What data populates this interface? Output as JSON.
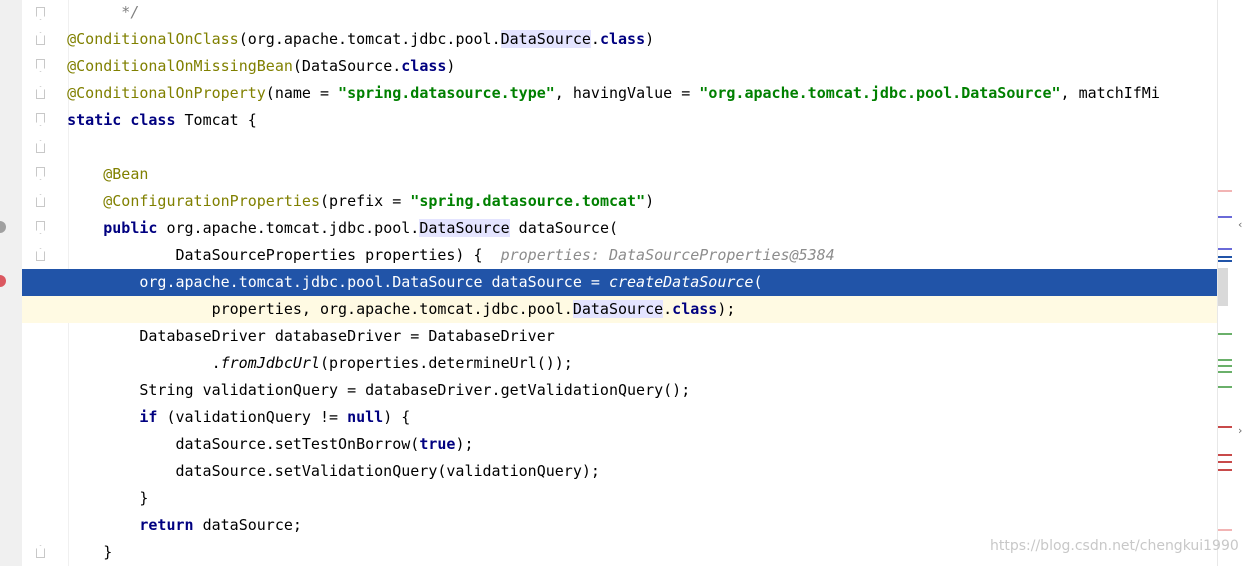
{
  "editor": {
    "lines": [
      {
        "indent": 10,
        "parts": [
          {
            "t": "*/",
            "c": "cmt"
          }
        ]
      },
      {
        "indent": 4,
        "parts": [
          {
            "t": "@ConditionalOnClass",
            "c": "ann"
          },
          {
            "t": "(org.apache.tomcat.jdbc.pool."
          },
          {
            "t": "DataSource",
            "c": "hl"
          },
          {
            "t": "."
          },
          {
            "t": "class",
            "c": "kw"
          },
          {
            "t": ")"
          }
        ]
      },
      {
        "indent": 4,
        "parts": [
          {
            "t": "@ConditionalOnMissingBean",
            "c": "ann"
          },
          {
            "t": "(DataSource."
          },
          {
            "t": "class",
            "c": "kw"
          },
          {
            "t": ")"
          }
        ]
      },
      {
        "indent": 4,
        "parts": [
          {
            "t": "@ConditionalOnProperty",
            "c": "ann"
          },
          {
            "t": "(name = "
          },
          {
            "t": "\"spring.datasource.type\"",
            "c": "str"
          },
          {
            "t": ", havingValue = "
          },
          {
            "t": "\"org.apache.tomcat.jdbc.pool.DataSource\"",
            "c": "str"
          },
          {
            "t": ", matchIfMi"
          }
        ]
      },
      {
        "indent": 4,
        "parts": [
          {
            "t": "static class",
            "c": "kw"
          },
          {
            "t": " Tomcat {"
          }
        ]
      },
      {
        "indent": 0,
        "parts": []
      },
      {
        "indent": 8,
        "parts": [
          {
            "t": "@Bean",
            "c": "ann"
          }
        ]
      },
      {
        "indent": 8,
        "parts": [
          {
            "t": "@ConfigurationProperties",
            "c": "ann"
          },
          {
            "t": "(prefix = "
          },
          {
            "t": "\"spring.datasource.tomcat\"",
            "c": "str"
          },
          {
            "t": ")"
          }
        ]
      },
      {
        "indent": 8,
        "parts": [
          {
            "t": "public",
            "c": "kw"
          },
          {
            "t": " org.apache.tomcat.jdbc.pool."
          },
          {
            "t": "DataSource",
            "c": "hl"
          },
          {
            "t": " dataSource("
          }
        ]
      },
      {
        "indent": 16,
        "parts": [
          {
            "t": "DataSourceProperties properties) {  "
          },
          {
            "t": "properties: DataSourceProperties@5384",
            "c": "hint"
          }
        ]
      },
      {
        "indent": 12,
        "row": "exec",
        "parts": [
          {
            "t": "org.apache.tomcat.jdbc.pool.DataSource dataSource = "
          },
          {
            "t": "createDataSource",
            "c": "it"
          },
          {
            "t": "("
          }
        ]
      },
      {
        "indent": 20,
        "row": "caret",
        "parts": [
          {
            "t": "properties, org.apache.tomcat.jdbc.pool."
          },
          {
            "t": "DataSource",
            "c": "hl"
          },
          {
            "t": "."
          },
          {
            "t": "class",
            "c": "kw"
          },
          {
            "t": ");"
          }
        ]
      },
      {
        "indent": 12,
        "parts": [
          {
            "t": "DatabaseDriver databaseDriver = DatabaseDriver"
          }
        ]
      },
      {
        "indent": 20,
        "parts": [
          {
            "t": "."
          },
          {
            "t": "fromJdbcUrl",
            "c": "it"
          },
          {
            "t": "(properties.determineUrl());"
          }
        ]
      },
      {
        "indent": 12,
        "parts": [
          {
            "t": "String validationQuery = databaseDriver.getValidationQuery();"
          }
        ]
      },
      {
        "indent": 12,
        "parts": [
          {
            "t": "if",
            "c": "kw"
          },
          {
            "t": " (validationQuery != "
          },
          {
            "t": "null",
            "c": "kw"
          },
          {
            "t": ") {"
          }
        ]
      },
      {
        "indent": 16,
        "parts": [
          {
            "t": "dataSource.setTestOnBorrow("
          },
          {
            "t": "true",
            "c": "kw"
          },
          {
            "t": ");"
          }
        ]
      },
      {
        "indent": 16,
        "parts": [
          {
            "t": "dataSource.setValidationQuery(validationQuery);"
          }
        ]
      },
      {
        "indent": 12,
        "parts": [
          {
            "t": "}"
          }
        ]
      },
      {
        "indent": 12,
        "parts": [
          {
            "t": "return",
            "c": "kw"
          },
          {
            "t": " dataSource;"
          }
        ]
      },
      {
        "indent": 8,
        "parts": [
          {
            "t": "}"
          }
        ]
      }
    ]
  },
  "scrollbar": {
    "markers": [
      {
        "at": 0.335,
        "color": "#f2b4b4"
      },
      {
        "at": 0.382,
        "color": "#6a6ad8"
      },
      {
        "at": 0.438,
        "color": "#6a6ad8"
      },
      {
        "at": 0.452,
        "color": "#2154a8"
      },
      {
        "at": 0.459,
        "color": "#2154a8"
      },
      {
        "at": 0.588,
        "color": "#6ab06a"
      },
      {
        "at": 0.635,
        "color": "#6ab06a"
      },
      {
        "at": 0.645,
        "color": "#6ab06a"
      },
      {
        "at": 0.655,
        "color": "#6ab06a"
      },
      {
        "at": 0.682,
        "color": "#6ab06a"
      },
      {
        "at": 0.752,
        "color": "#c84a4a"
      },
      {
        "at": 0.802,
        "color": "#c84a4a"
      },
      {
        "at": 0.815,
        "color": "#c84a4a"
      },
      {
        "at": 0.828,
        "color": "#c84a4a"
      },
      {
        "at": 0.935,
        "color": "#f2b4b4"
      }
    ]
  },
  "watermark": "https://blog.csdn.net/chengkui1990"
}
